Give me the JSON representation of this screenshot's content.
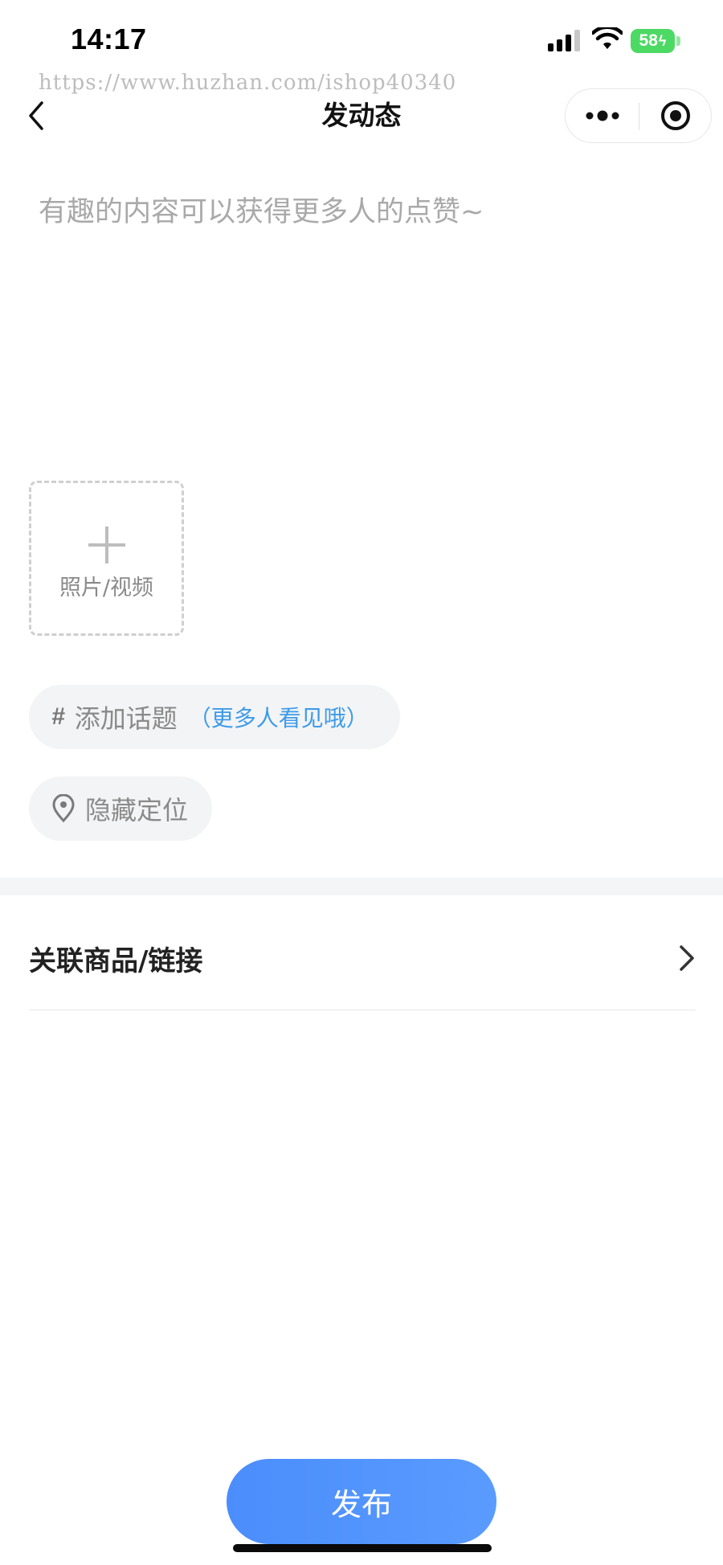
{
  "status_bar": {
    "time": "14:17",
    "battery": "58"
  },
  "watermark": "https://www.huzhan.com/ishop40340",
  "nav": {
    "title": "发动态",
    "back_icon": "chevron-left-icon",
    "more_icon": "more-dots-icon",
    "target_icon": "target-circle-icon"
  },
  "editor": {
    "placeholder": "有趣的内容可以获得更多人的点赞~",
    "value": ""
  },
  "upload": {
    "label": "照片/视频",
    "icon": "plus-icon"
  },
  "topic": {
    "label": "添加话题",
    "hint": "（更多人看见哦）",
    "hint_color": "#3d9be9"
  },
  "location": {
    "label": "隐藏定位",
    "icon": "location-pin-icon"
  },
  "linked_product": {
    "label": "关联商品/链接",
    "icon": "chevron-right-icon"
  },
  "publish": {
    "label": "发布",
    "color": "#4b8dfb"
  }
}
